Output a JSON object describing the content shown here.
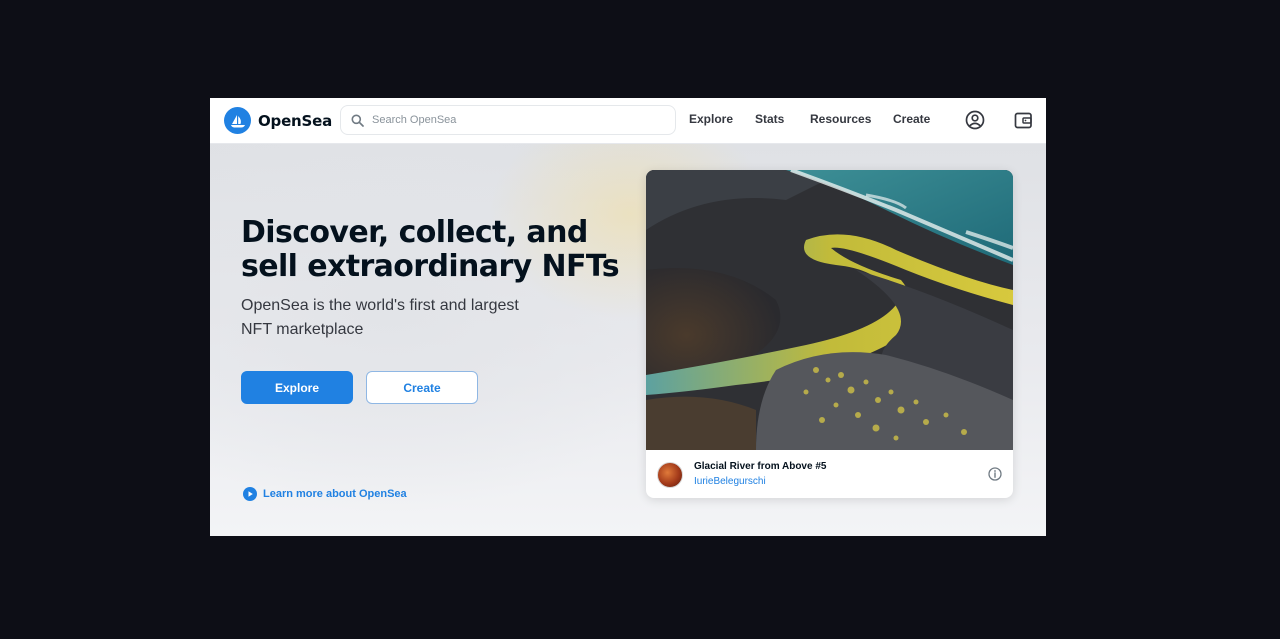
{
  "header": {
    "brand_name": "OpenSea",
    "search_placeholder": "Search OpenSea",
    "nav": [
      {
        "label": "Explore"
      },
      {
        "label": "Stats"
      },
      {
        "label": "Resources"
      },
      {
        "label": "Create"
      }
    ],
    "icons": [
      "profile-icon",
      "wallet-icon",
      "search-icon",
      "opensea-logo-icon"
    ]
  },
  "hero": {
    "headline": "Discover, collect, and sell extraordinary NFTs",
    "subhead": "OpenSea is the world's first and largest NFT marketplace",
    "primary_button": "Explore",
    "secondary_button": "Create",
    "learn_more": "Learn more about OpenSea"
  },
  "featured_card": {
    "title": "Glacial River from Above #5",
    "creator": "IurieBelegurschi"
  },
  "colors": {
    "accent": "#2081e2",
    "text_dark": "#04111d",
    "backdrop": "#0d0e16"
  }
}
